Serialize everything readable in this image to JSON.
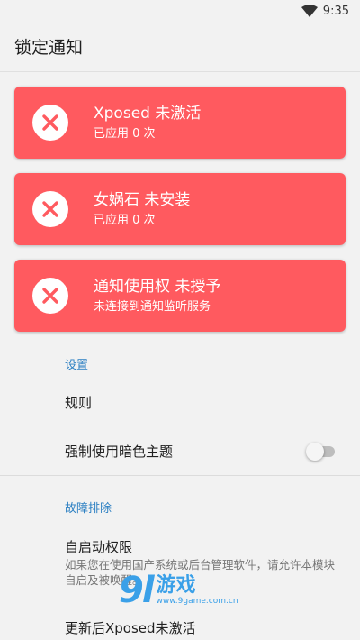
{
  "status_bar": {
    "time": "9:35"
  },
  "app_bar": {
    "title": "锁定通知"
  },
  "cards": [
    {
      "title": "Xposed 未激活",
      "subtitle": "已应用 0 次"
    },
    {
      "title": "女娲石 未安装",
      "subtitle": "已应用 0 次"
    },
    {
      "title": "通知使用权 未授予",
      "subtitle": "未连接到通知监听服务"
    }
  ],
  "settings": {
    "header": "设置",
    "rules_label": "规则",
    "dark_theme_label": "强制使用暗色主题",
    "dark_theme_enabled": false
  },
  "troubleshooting": {
    "header": "故障排除",
    "autostart_title": "自启动权限",
    "autostart_summary": "如果您在使用国产系统或后台管理软件，请允许本模块自启及被唤醒。",
    "update_title": "更新后Xposed未激活"
  },
  "watermark": {
    "logo": "9l",
    "main": "游戏",
    "sub": "www.9game.com.cn"
  },
  "colors": {
    "card_bg": "#ff5a5f",
    "accent": "#2b7fc2",
    "background": "#f2f2f2"
  },
  "icons": {
    "card_icon": "close-circle-icon",
    "status_icon": "wifi-icon"
  }
}
